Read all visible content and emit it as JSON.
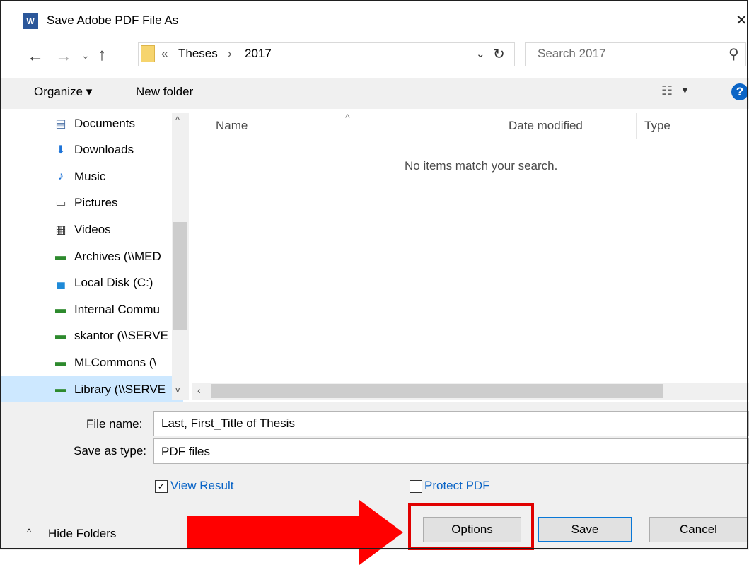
{
  "window": {
    "title": "Save Adobe PDF File As",
    "app_icon": "word-icon",
    "app_icon_text": "W"
  },
  "address": {
    "crumb_prefix": "«",
    "crumbs": [
      "Theses",
      "2017"
    ],
    "separator": "›"
  },
  "search": {
    "placeholder": "Search 2017"
  },
  "toolbar": {
    "organize": "Organize ▾",
    "new_folder": "New folder",
    "help": "?"
  },
  "nav": {
    "items": [
      {
        "label": "Documents",
        "icon": "documents-icon"
      },
      {
        "label": "Downloads",
        "icon": "downloads-icon"
      },
      {
        "label": "Music",
        "icon": "music-icon"
      },
      {
        "label": "Pictures",
        "icon": "pictures-icon"
      },
      {
        "label": "Videos",
        "icon": "videos-icon"
      },
      {
        "label": "Archives (\\\\MED",
        "icon": "network-drive-icon"
      },
      {
        "label": "Local Disk (C:)",
        "icon": "local-disk-icon"
      },
      {
        "label": "Internal Commu",
        "icon": "network-drive-icon"
      },
      {
        "label": "skantor (\\\\SERVE",
        "icon": "network-drive-icon"
      },
      {
        "label": "MLCommons (\\",
        "icon": "network-drive-icon"
      },
      {
        "label": "Library (\\\\SERVE",
        "icon": "network-drive-icon",
        "selected": true
      }
    ]
  },
  "list": {
    "columns": [
      "Name",
      "Date modified",
      "Type"
    ],
    "empty_message": "No items match your search."
  },
  "form": {
    "file_name_label": "File name:",
    "file_name_value": "Last, First_Title of Thesis",
    "save_type_label": "Save as type:",
    "save_type_value": "PDF files",
    "view_result_label": "View Result",
    "view_result_checked": true,
    "protect_pdf_label": "Protect PDF",
    "protect_pdf_checked": false
  },
  "footer": {
    "hide_folders": "Hide Folders"
  },
  "buttons": {
    "options": "Options",
    "save": "Save",
    "cancel": "Cancel"
  },
  "annotation": {
    "highlight_color": "#e00000",
    "arrow_color": "#ff0000"
  }
}
